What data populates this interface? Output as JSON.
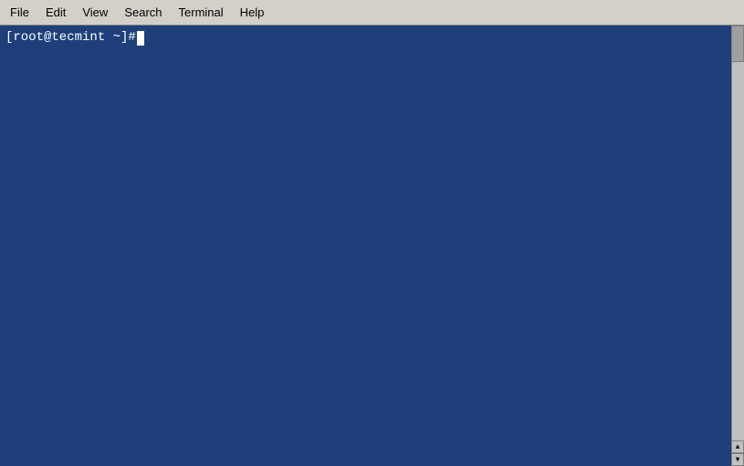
{
  "menubar": {
    "items": [
      {
        "id": "file",
        "label": "File",
        "underline_index": 0
      },
      {
        "id": "edit",
        "label": "Edit",
        "underline_index": 0
      },
      {
        "id": "view",
        "label": "View",
        "underline_index": 0
      },
      {
        "id": "search",
        "label": "Search",
        "underline_index": 0
      },
      {
        "id": "terminal",
        "label": "Terminal",
        "underline_index": 0
      },
      {
        "id": "help",
        "label": "Help",
        "underline_index": 0
      }
    ]
  },
  "terminal": {
    "prompt": "[root@tecmint ~]# ",
    "background_color": "#1e3f7a",
    "text_color": "#ffffff"
  }
}
